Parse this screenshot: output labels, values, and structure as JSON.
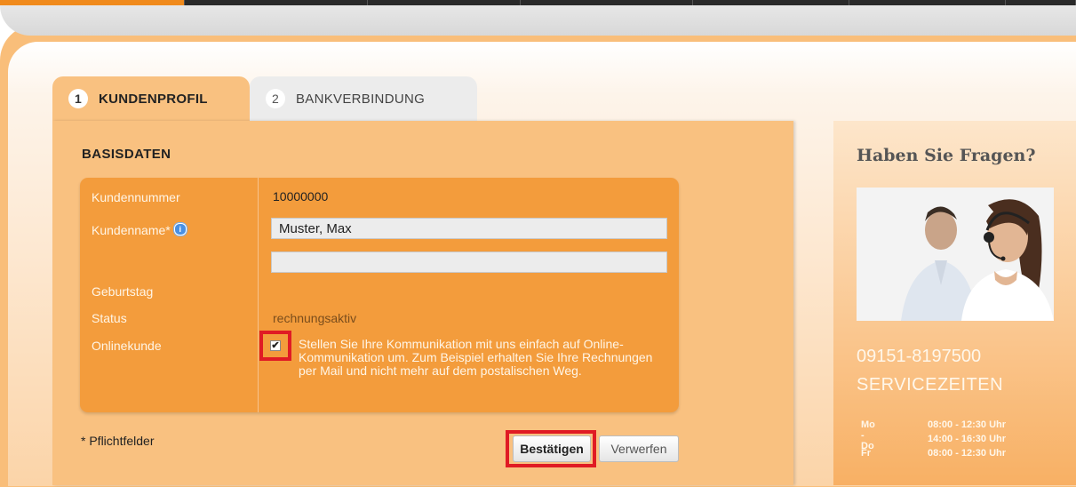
{
  "tabs": [
    {
      "number": "1",
      "label": "KUNDENPROFIL"
    },
    {
      "number": "2",
      "label": "BANKVERBINDUNG"
    }
  ],
  "section": {
    "title": "BASISDATEN"
  },
  "form": {
    "customer_number_label": "Kundennummer",
    "customer_number_value": "10000000",
    "customer_name_label": "Kundenname*",
    "customer_name_value": "Muster, Max",
    "customer_name2_value": "",
    "birthday_label": "Geburtstag",
    "status_label": "Status",
    "status_value": "rechnungsaktiv",
    "online_label": "Onlinekunde",
    "online_checked": true,
    "online_text": "Stellen Sie Ihre Kommunikation mit uns einfach auf Online-Kommunikation um. Zum Beispiel erhalten Sie Ihre Rechnungen per Mail und nicht mehr auf dem postalischen Weg."
  },
  "footnote": "* Pflichtfelder",
  "buttons": {
    "confirm": "Bestätigen",
    "discard": "Verwerfen"
  },
  "sidebar": {
    "title": "Haben Sie Fragen?",
    "phone": "09151-8197500",
    "service_title": "SERVICEZEITEN",
    "hours": [
      {
        "day": "Mo - Do",
        "time": "08:00 - 12:30 Uhr"
      },
      {
        "day": "",
        "time": "14:00 - 16:30 Uhr"
      },
      {
        "day": "Fr",
        "time": "08:00 - 12:30 Uhr"
      }
    ]
  },
  "colors": {
    "accent": "#f39c3c",
    "highlight": "#e01b24",
    "info": "#4a90e2"
  },
  "icons": {
    "info": "info-icon",
    "checkmark": "checkmark-icon"
  }
}
